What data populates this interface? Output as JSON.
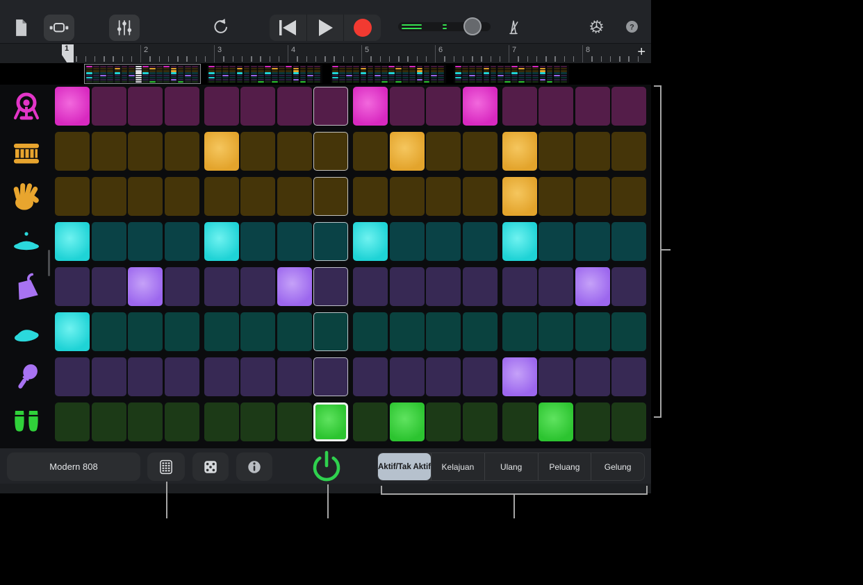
{
  "toolbar": {
    "icon_names": [
      "document-icon",
      "song-sections-icon",
      "mixer-icon",
      "undo-icon",
      "rewind-icon",
      "play-icon",
      "record-icon",
      "volume-slider",
      "metronome-icon",
      "settings-gear-icon",
      "help-icon"
    ],
    "help_label": "?"
  },
  "ruler": {
    "bars": [
      "1",
      "2",
      "3",
      "4",
      "5",
      "6",
      "7",
      "8"
    ],
    "add_label": "+"
  },
  "regions": {
    "count": 4,
    "selected_index": 0
  },
  "sequencer": {
    "steps_per_row": 16,
    "playhead_step": 8,
    "rows": [
      {
        "instrument": "kick-drum",
        "icon": "kick",
        "icon_color": "#e335c8",
        "color_dim": "#541d49",
        "color_on": "#d829c0",
        "color_hi": "#f268dd",
        "steps": [
          1,
          0,
          0,
          0,
          0,
          0,
          0,
          0,
          1,
          0,
          0,
          1,
          0,
          0,
          0,
          0
        ]
      },
      {
        "instrument": "snare-drum",
        "icon": "snare",
        "icon_color": "#e8a52e",
        "color_dim": "#453509",
        "color_on": "#e3a42c",
        "color_hi": "#f5c65e",
        "steps": [
          0,
          0,
          0,
          0,
          1,
          0,
          0,
          0,
          0,
          1,
          0,
          0,
          1,
          0,
          0,
          0
        ]
      },
      {
        "instrument": "hand-clap",
        "icon": "clap",
        "icon_color": "#e8a52e",
        "color_dim": "#453509",
        "color_on": "#e3a42c",
        "color_hi": "#f5c65e",
        "steps": [
          0,
          0,
          0,
          0,
          0,
          0,
          0,
          0,
          0,
          0,
          0,
          0,
          1,
          0,
          0,
          0
        ]
      },
      {
        "instrument": "hi-hat",
        "icon": "hihat",
        "icon_color": "#2bd9dc",
        "color_dim": "#0a4246",
        "color_on": "#1fd3d6",
        "color_hi": "#6ff2f0",
        "steps": [
          1,
          0,
          0,
          0,
          1,
          0,
          0,
          0,
          1,
          0,
          0,
          0,
          1,
          0,
          0,
          0
        ]
      },
      {
        "instrument": "cowbell",
        "icon": "cowbell",
        "icon_color": "#a873f2",
        "color_dim": "#372954",
        "color_on": "#9c67ee",
        "color_hi": "#c5a1f8",
        "steps": [
          0,
          0,
          1,
          0,
          0,
          0,
          1,
          0,
          0,
          0,
          0,
          0,
          0,
          0,
          1,
          0
        ]
      },
      {
        "instrument": "ride-cymbal",
        "icon": "ride",
        "icon_color": "#2bd9dc",
        "color_dim": "#0a423f",
        "color_on": "#1fd3d6",
        "color_hi": "#6ff2f0",
        "steps": [
          1,
          0,
          0,
          0,
          0,
          0,
          0,
          0,
          0,
          0,
          0,
          0,
          0,
          0,
          0,
          0
        ]
      },
      {
        "instrument": "maracas",
        "icon": "maracas",
        "icon_color": "#a873f2",
        "color_dim": "#372954",
        "color_on": "#9c67ee",
        "color_hi": "#c5a1f8",
        "steps": [
          0,
          0,
          0,
          0,
          0,
          0,
          0,
          0,
          0,
          0,
          0,
          0,
          1,
          0,
          0,
          0
        ]
      },
      {
        "instrument": "congas",
        "icon": "congas",
        "icon_color": "#30d13a",
        "color_dim": "#1c3a17",
        "color_on": "#2cc430",
        "color_hi": "#5fe35f",
        "steps": [
          0,
          0,
          0,
          0,
          0,
          0,
          0,
          1,
          0,
          1,
          0,
          0,
          0,
          1,
          0,
          0
        ]
      }
    ]
  },
  "footer": {
    "kit_name": "Modern 808",
    "icon_names": [
      "kit-keypad-icon",
      "dice-icon",
      "info-icon",
      "power-icon"
    ],
    "tabs": [
      {
        "label": "Aktif/Tak Aktif",
        "selected": true
      },
      {
        "label": "Kelajuan",
        "selected": false
      },
      {
        "label": "Ulang",
        "selected": false
      },
      {
        "label": "Peluang",
        "selected": false
      },
      {
        "label": "Gelung",
        "selected": false
      }
    ]
  },
  "colors": {
    "accent_green": "#2fd14e",
    "record_red": "#f23a31",
    "playhead_border": "#eef2ef",
    "callout": "#a6a6a6",
    "selected_tab_bg": "#b6c1cd"
  }
}
